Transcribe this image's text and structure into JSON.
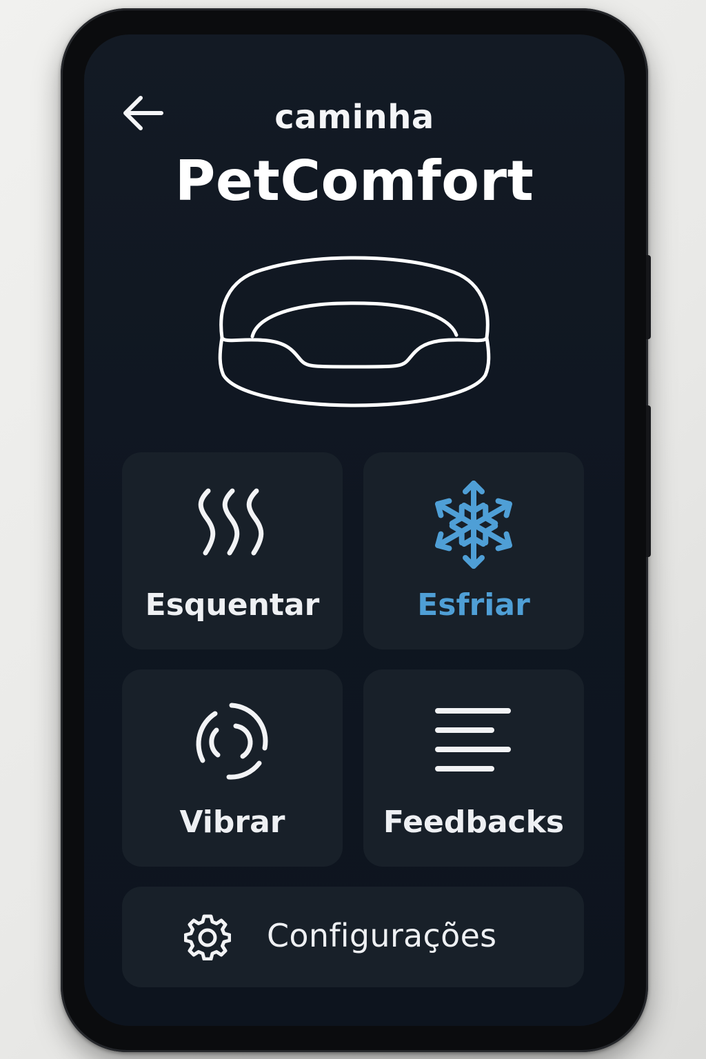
{
  "colors": {
    "accent": "#4f9fd6",
    "text": "#eef0f3",
    "card_background": "#182029",
    "screen_background": "#0f1621"
  },
  "header": {
    "back_icon": "arrow-left-icon",
    "subtitle": "caminha",
    "title": "PetComfort"
  },
  "illustration": {
    "icon": "pet-bed-icon"
  },
  "controls": {
    "heat": {
      "label": "Esquentar",
      "icon": "heat-waves-icon"
    },
    "cool": {
      "label": "Esfriar",
      "icon": "snowflake-icon",
      "active": true
    },
    "vibrate": {
      "label": "Vibrar",
      "icon": "vibration-icon"
    },
    "feedback": {
      "label": "Feedbacks",
      "icon": "lines-icon"
    }
  },
  "settings": {
    "label": "Configurações",
    "icon": "gear-icon"
  }
}
